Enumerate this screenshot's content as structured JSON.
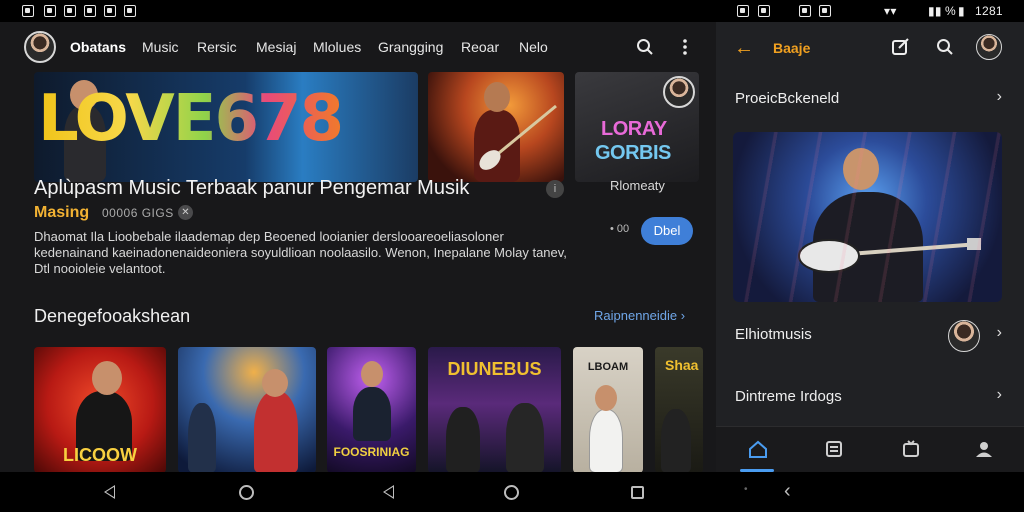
{
  "status_bar": {
    "time": "1281",
    "battery": "%"
  },
  "app": {
    "nav_tabs": [
      {
        "label": "Obatans",
        "active": true
      },
      {
        "label": "Music"
      },
      {
        "label": "Rersic"
      },
      {
        "label": "Mesiaj"
      },
      {
        "label": "Mlolues"
      },
      {
        "label": "Grangging"
      },
      {
        "label": "Reoar"
      },
      {
        "label": "Nelo"
      }
    ],
    "hero": {
      "main_logo": "LOVE678",
      "side_logo_1": "LORAY",
      "side_logo_2": "GORBIS",
      "side_caption": "Rlomeaty"
    },
    "feature": {
      "title": "Aplùpasm Music Terbaak panur Pengemar Musik",
      "artist": "Masing",
      "meta": "00006 GIGS",
      "description": "Dhaomat Ila Lioobebale ilaademap dep Beoened looianier derslooareoeliasoloner kedenainand kaeinadonenaideoniera soyuldlioan noolaasilo. Wenon, Inepalane Molay tanev, Dtl nooioleie velantoot.",
      "dots": "• 00",
      "action_label": "Dbel"
    },
    "section": {
      "title": "Denegefooakshean",
      "see_all": "Raipnenneidie"
    },
    "cards": [
      {
        "text": "LICOOW"
      },
      {
        "text": ""
      },
      {
        "text": "FOOSRINIAG"
      },
      {
        "text": "DIUNEBUS"
      },
      {
        "text": "LBOAM"
      },
      {
        "text": "Shaa"
      }
    ]
  },
  "right_panel": {
    "title": "Baaje",
    "rows": [
      {
        "label": "ProeicBckeneld"
      },
      {
        "label": "Elhiotmusis"
      },
      {
        "label": "Dintreme Irdogs"
      }
    ],
    "bottom_nav": [
      {
        "icon": "home-icon",
        "active": true
      },
      {
        "icon": "library-icon"
      },
      {
        "icon": "cast-icon"
      },
      {
        "icon": "profile-icon"
      }
    ]
  },
  "colors": {
    "accent_orange": "#f0a020",
    "accent_blue": "#3f7fd8",
    "artist_gold": "#f2b233",
    "background": "#18181a"
  }
}
